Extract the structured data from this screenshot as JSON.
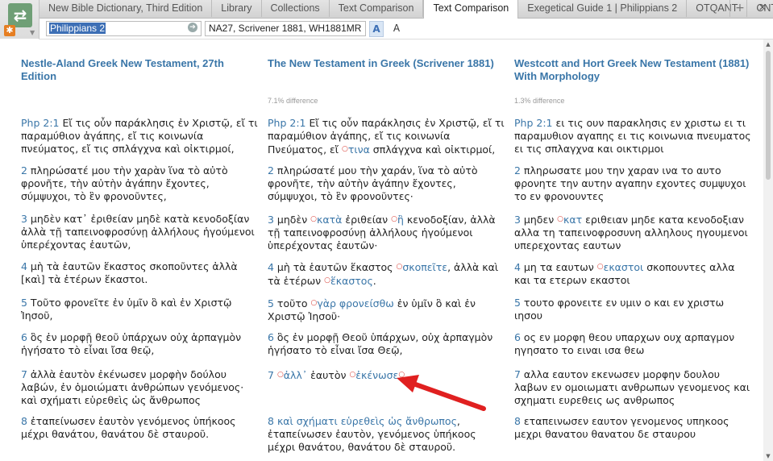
{
  "tabs": [
    {
      "label": "New Bible Dictionary, Third Edition",
      "active": false
    },
    {
      "label": "Library",
      "active": false
    },
    {
      "label": "Collections",
      "active": false
    },
    {
      "label": "Text Comparison",
      "active": false
    },
    {
      "label": "Text Comparison",
      "active": true
    },
    {
      "label": "Exegetical Guide 1 | Philippians 2",
      "active": false
    },
    {
      "label": "OTQANT",
      "active": false
    },
    {
      "label": "CNTUOT",
      "active": false
    }
  ],
  "tab_add": "+",
  "tab_close": "×",
  "toolbar": {
    "reference": "Philippians 2",
    "versions": "NA27, Scrivener 1881, WH1881MR",
    "font_a1": "A",
    "font_a2": "A"
  },
  "columns": [
    {
      "title": "Nestle-Aland Greek New Testament, 27th Edition",
      "difference": "",
      "verses": [
        {
          "num": "Php 2:1",
          "html": "Εἴ τις οὖν παράκλησις ἐν Χριστῷ, εἴ τι παραμύθιον ἀγάπης, εἴ τις κοινωνία πνεύματος, εἴ τις σπλάγχνα καὶ οἰκτιρμοί,"
        },
        {
          "num": "2",
          "html": "πληρώσατέ μου τὴν χαρὰν ἵνα τὸ αὐτὸ φρονῆτε, τὴν αὐτὴν ἀγάπην ἔχοντες, σύμψυχοι, τὸ ἓν φρονοῦντες,"
        },
        {
          "num": "3",
          "html": "μηδὲν κατ᾽ ἐριθείαν μηδὲ κατὰ κενοδοξίαν ἀλλὰ τῇ ταπεινοφροσύνῃ ἀλλήλους ἡγούμενοι ὑπερέχοντας ἑαυτῶν,"
        },
        {
          "num": "4",
          "html": "μὴ τὰ ἑαυτῶν ἕκαστος σκοποῦντες ἀλλὰ [καὶ] τὰ ἑτέρων ἕκαστοι."
        },
        {
          "num": "5",
          "html": "Τοῦτο φρονεῖτε ἐν ὑμῖν ὃ καὶ ἐν Χριστῷ Ἰησοῦ,"
        },
        {
          "num": "6",
          "html": "ὃς ἐν μορφῇ θεοῦ ὑπάρχων οὐχ ἁρπαγμὸν ἡγήσατο τὸ εἶναι ἴσα θεῷ,"
        },
        {
          "num": "7",
          "html": "ἀλλὰ ἑαυτὸν ἐκένωσεν μορφὴν δούλου λαβών, ἐν ὁμοιώματι ἀνθρώπων γενόμενος· καὶ σχήματι εὑρεθεὶς ὡς ἄνθρωπος"
        },
        {
          "num": "8",
          "html": "ἐταπείνωσεν ἑαυτὸν γενόμενος ὑπήκοος μέχρι θανάτου, θανάτου δὲ σταυροῦ."
        }
      ]
    },
    {
      "title": "The New Testament in Greek (Scrivener 1881)",
      "difference": "7.1% difference",
      "verses": [
        {
          "num": "Php 2:1",
          "html": "Εἴ τις οὖν παράκλησις ἐν Χριστῷ, εἴ τι παραμύθιον ἀγάπης, εἴ τις κοινωνία Πνεύματος, εἴ <span class=\"dot\">○</span><span class=\"chg\">τινα</span> σπλάγχνα καὶ οἰκτιρμοί,"
        },
        {
          "num": "2",
          "html": "πληρώσατέ μου τὴν χαράν, ἵνα τὸ αὐτὸ φρονῆτε, τὴν αὐτὴν ἀγάπην ἔχοντες, σύμψυχοι, τὸ ἓν φρονοῦντες·"
        },
        {
          "num": "3",
          "html": "μηδὲν <span class=\"dot\">○</span><span class=\"chg\">κατὰ</span> ἐριθείαν <span class=\"dot\">○</span><span class=\"chg\">ἢ</span> κενοδοξίαν, ἀλλὰ τῇ ταπεινοφροσύνῃ ἀλλήλους ἡγούμενοι ὑπερέχοντας ἑαυτῶν·"
        },
        {
          "num": "4",
          "html": "μὴ τὰ ἑαυτῶν ἕκαστος <span class=\"dot\">○</span><span class=\"chg\">σκοπεῖτε</span>, ἀλλὰ καὶ τὰ ἑτέρων <span class=\"dot\">○</span><span class=\"chg\">ἕκαστος</span>."
        },
        {
          "num": "5",
          "html": "τοῦτο <span class=\"dot\">○</span><span class=\"chg\">γὰρ φρονείσθω</span> ἐν ὑμῖν ὃ καὶ ἐν Χριστῷ Ἰησοῦ·"
        },
        {
          "num": "6",
          "html": "ὃς ἐν μορφῇ Θεοῦ ὑπάρχων, οὐχ ἁρπαγμὸν ἡγήσατο τὸ εἶναι ἴσα Θεῷ,"
        },
        {
          "num": "7",
          "html": "<span class=\"dot\">○</span><span class=\"chg\">ἀλλ᾽</span> ἑαυτὸν <span class=\"dot\">○</span><span class=\"chg\">ἐκένωσε</span><span class=\"dot\">○</span>"
        },
        {
          "num": "8",
          "html": "<span class=\"chg\">καὶ σχήματι εὑρεθεὶς ὡς ἄνθρωπος</span>, ἐταπείνωσεν ἑαυτὸν, γενόμενος ὑπήκοος μέχρι θανάτου, θανάτου δὲ σταυροῦ."
        }
      ]
    },
    {
      "title": "Westcott and Hort Greek New Testament (1881) With Morphology",
      "difference": "1.3% difference",
      "verses": [
        {
          "num": "Php 2:1",
          "html": "ει τις ουν παρακλησις εν χριστω ει τι παραμυθιον αγαπης ει τις κοινωνια πνευματος ει τις σπλαγχνα και οικτιρμοι"
        },
        {
          "num": "2",
          "html": "πληρωσατε μου την χαραν ινα το αυτο φρονητε την αυτην αγαπην εχοντες συμψυχοι το εν φρονουντες"
        },
        {
          "num": "3",
          "html": "μηδεν <span class=\"dot\">○</span><span class=\"chg\">κατ</span> εριθειαν μηδε κατα κενοδοξιαν αλλα τη ταπεινοφροσυνη αλληλους ηγουμενοι υπερεχοντας εαυτων"
        },
        {
          "num": "4",
          "html": "μη τα εαυτων <span class=\"dot\">○</span><span class=\"chg\">εκαστοι</span> σκοπουντες αλλα και τα ετερων εκαστοι"
        },
        {
          "num": "5",
          "html": "τουτο φρονειτε εν υμιν ο και εν χριστω ιησου"
        },
        {
          "num": "6",
          "html": "ος εν μορφη θεου υπαρχων ουχ αρπαγμον ηγησατο το ειναι ισα θεω"
        },
        {
          "num": "7",
          "html": "αλλα εαυτον εκενωσεν μορφην δουλου λαβων εν ομοιωματι ανθρωπων γενομενος και σχηματι ευρεθεις ως ανθρωπος"
        },
        {
          "num": "8",
          "html": "εταπεινωσεν εαυτον γενομενος υπηκοος μεχρι θανατου θανατου δε σταυρου"
        }
      ]
    }
  ],
  "colors": {
    "link_blue": "#3a76a8",
    "change_dot": "#d9423a",
    "arrow": "#e02020"
  }
}
